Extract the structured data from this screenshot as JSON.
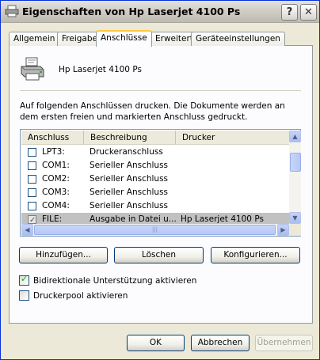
{
  "window": {
    "title": "Eigenschaften von Hp Laserjet 4100 Ps",
    "help_glyph": "?",
    "close_glyph": "✕"
  },
  "tabs": [
    {
      "label": "Allgemein",
      "active": false
    },
    {
      "label": "Freigabe",
      "active": false
    },
    {
      "label": "Anschlüsse",
      "active": true
    },
    {
      "label": "Erweitert",
      "active": false
    },
    {
      "label": "Geräteeinstellungen",
      "active": false
    }
  ],
  "printer": {
    "name": "Hp Laserjet 4100 Ps",
    "icon": "printer-icon"
  },
  "description": "Auf folgenden Anschlüssen drucken. Die Dokumente werden an dem ersten freien und markierten Anschluss gedruckt.",
  "ports_list": {
    "columns": [
      "Anschluss",
      "Beschreibung",
      "Drucker"
    ],
    "rows": [
      {
        "port": "LPT3:",
        "description": "Druckeranschluss",
        "printer": "",
        "checked": false,
        "selected": false
      },
      {
        "port": "COM1:",
        "description": "Serieller Anschluss",
        "printer": "",
        "checked": false,
        "selected": false
      },
      {
        "port": "COM2:",
        "description": "Serieller Anschluss",
        "printer": "",
        "checked": false,
        "selected": false
      },
      {
        "port": "COM3:",
        "description": "Serieller Anschluss",
        "printer": "",
        "checked": false,
        "selected": false
      },
      {
        "port": "COM4:",
        "description": "Serieller Anschluss",
        "printer": "",
        "checked": false,
        "selected": false
      },
      {
        "port": "FILE:",
        "description": "Ausgabe in Datei u...",
        "printer": "Hp Laserjet 4100 Ps",
        "checked": true,
        "selected": true
      }
    ]
  },
  "buttons": {
    "add": "Hinzufügen...",
    "delete": "Löschen",
    "configure": "Konfigurieren...",
    "ok": "OK",
    "cancel": "Abbrechen",
    "apply": "Übernehmen"
  },
  "options": {
    "bidirectional": {
      "label": "Bidirektionale Unterstützung aktivieren",
      "checked": true
    },
    "pool": {
      "label": "Druckerpool aktivieren",
      "checked": false
    }
  },
  "colors": {
    "selection": "#c1c1c1",
    "tab_highlight": "#ffc83c",
    "button_border": "#003c74"
  }
}
